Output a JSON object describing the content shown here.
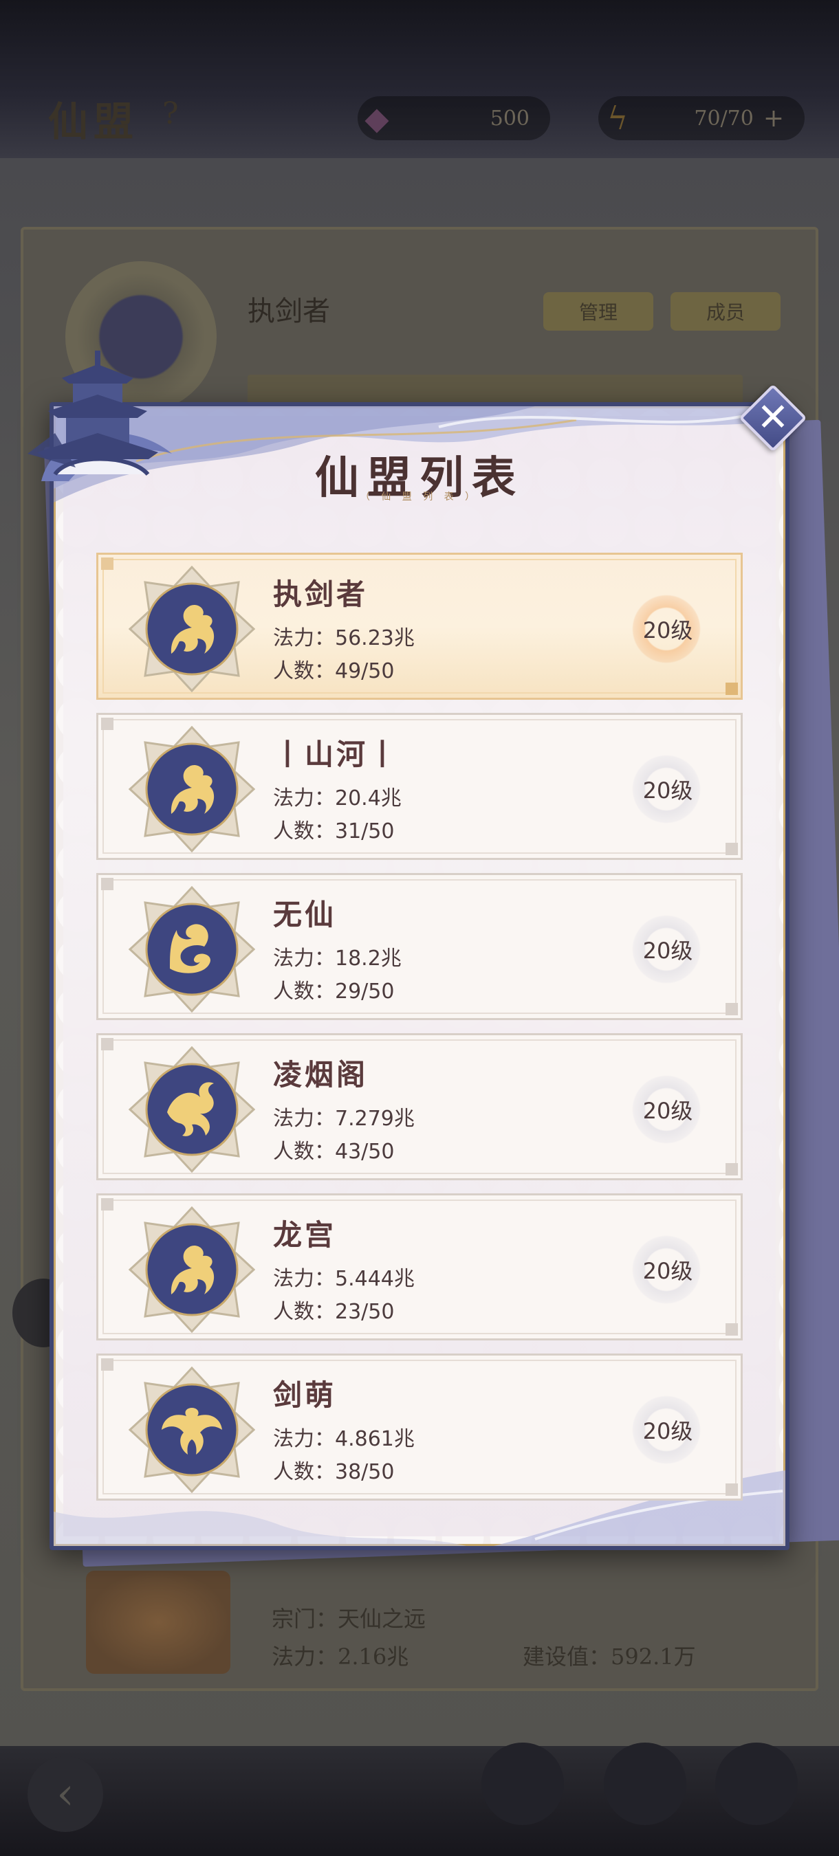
{
  "background": {
    "title": "仙盟",
    "help_icon": "?",
    "resource_1": "500",
    "resource_2": "70/70",
    "plus_icon": "+",
    "my_guild_name": "执剑者",
    "btn_1": "管理",
    "btn_2": "成员",
    "row_1": "宗门：天仙之远",
    "row_2": "法力：2.16兆",
    "row_3": "建设值：592.1万"
  },
  "popup": {
    "title": "仙盟列表",
    "subtitle": "（ 仙 盟 列 表 ）",
    "close_label": "✕"
  },
  "guilds": [
    {
      "name": "执剑者",
      "power_label": "法力：",
      "power": "56.23兆",
      "members_label": "人数：",
      "members": "49/50",
      "level": "20级",
      "selected": true
    },
    {
      "name": "丨山河丨",
      "power_label": "法力：",
      "power": "20.4兆",
      "members_label": "人数：",
      "members": "31/50",
      "level": "20级",
      "selected": false
    },
    {
      "name": "无仙",
      "power_label": "法力：",
      "power": "18.2兆",
      "members_label": "人数：",
      "members": "29/50",
      "level": "20级",
      "selected": false
    },
    {
      "name": "凌烟阁",
      "power_label": "法力：",
      "power": "7.279兆",
      "members_label": "人数：",
      "members": "43/50",
      "level": "20级",
      "selected": false
    },
    {
      "name": "龙宫",
      "power_label": "法力：",
      "power": "5.444兆",
      "members_label": "人数：",
      "members": "23/50",
      "level": "20级",
      "selected": false
    },
    {
      "name": "剑萌",
      "power_label": "法力：",
      "power": "4.861兆",
      "members_label": "人数：",
      "members": "38/50",
      "level": "20级",
      "selected": false
    }
  ],
  "colors": {
    "accent": "#424a82",
    "gold": "#e5c58c",
    "selected_bg": "#fbeedc"
  }
}
